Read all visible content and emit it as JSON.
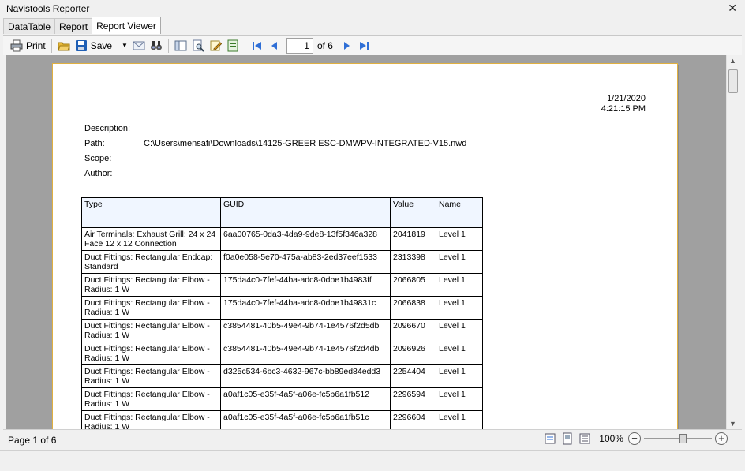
{
  "window": {
    "title": "Navistools Reporter"
  },
  "tabs": [
    {
      "label": "DataTable",
      "active": false
    },
    {
      "label": "Report",
      "active": false
    },
    {
      "label": "Report Viewer",
      "active": true
    }
  ],
  "toolbar": {
    "print_label": "Print",
    "save_label": "Save",
    "current_page": "1",
    "page_of": "of 6"
  },
  "report": {
    "date": "1/21/2020",
    "time": "4:21:15 PM",
    "meta": [
      {
        "key": "Description:",
        "value": ""
      },
      {
        "key": "Path:",
        "value": "C:\\Users\\mensafi\\Downloads\\14125-GREER ESC-DMWPV-INTEGRATED-V15.nwd"
      },
      {
        "key": "Scope:",
        "value": ""
      },
      {
        "key": "Author:",
        "value": ""
      }
    ],
    "columns": [
      "Type",
      "GUID",
      "Value",
      "Name"
    ],
    "rows": [
      {
        "type": "Air Terminals: Exhaust Grill: 24 x 24 Face 12 x 12 Connection",
        "guid": "6aa00765-0da3-4da9-9de8-13f5f346a328",
        "value": "2041819",
        "name": "Level 1"
      },
      {
        "type": "Duct Fittings: Rectangular Endcap: Standard",
        "guid": "f0a0e058-5e70-475a-ab83-2ed37eef1533",
        "value": "2313398",
        "name": "Level 1"
      },
      {
        "type": "Duct Fittings: Rectangular Elbow - Radius: 1 W",
        "guid": "175da4c0-7fef-44ba-adc8-0dbe1b4983ff",
        "value": "2066805",
        "name": "Level 1"
      },
      {
        "type": "Duct Fittings: Rectangular Elbow - Radius: 1 W",
        "guid": "175da4c0-7fef-44ba-adc8-0dbe1b49831c",
        "value": "2066838",
        "name": "Level 1"
      },
      {
        "type": "Duct Fittings: Rectangular Elbow - Radius: 1 W",
        "guid": "c3854481-40b5-49e4-9b74-1e4576f2d5db",
        "value": "2096670",
        "name": "Level 1"
      },
      {
        "type": "Duct Fittings: Rectangular Elbow - Radius: 1 W",
        "guid": "c3854481-40b5-49e4-9b74-1e4576f2d4db",
        "value": "2096926",
        "name": "Level 1"
      },
      {
        "type": "Duct Fittings: Rectangular Elbow - Radius: 1 W",
        "guid": "d325c534-6bc3-4632-967c-bb89ed84edd3",
        "value": "2254404",
        "name": "Level 1"
      },
      {
        "type": "Duct Fittings: Rectangular Elbow - Radius: 1 W",
        "guid": "a0af1c05-e35f-4a5f-a06e-fc5b6a1fb512",
        "value": "2296594",
        "name": "Level 1"
      },
      {
        "type": "Duct Fittings: Rectangular Elbow - Radius: 1 W",
        "guid": "a0af1c05-e35f-4a5f-a06e-fc5b6a1fb51c",
        "value": "2296604",
        "name": "Level 1"
      }
    ]
  },
  "status": {
    "page_text": "Page 1 of 6",
    "zoom": "100%",
    "zoom_level_percent": 100
  },
  "icons": {
    "colors": {
      "nav_blue": "#2f6fd6",
      "save_blue": "#1f5fb5",
      "folder_yellow": "#e8b93a",
      "page_border": "#e0b040"
    }
  }
}
